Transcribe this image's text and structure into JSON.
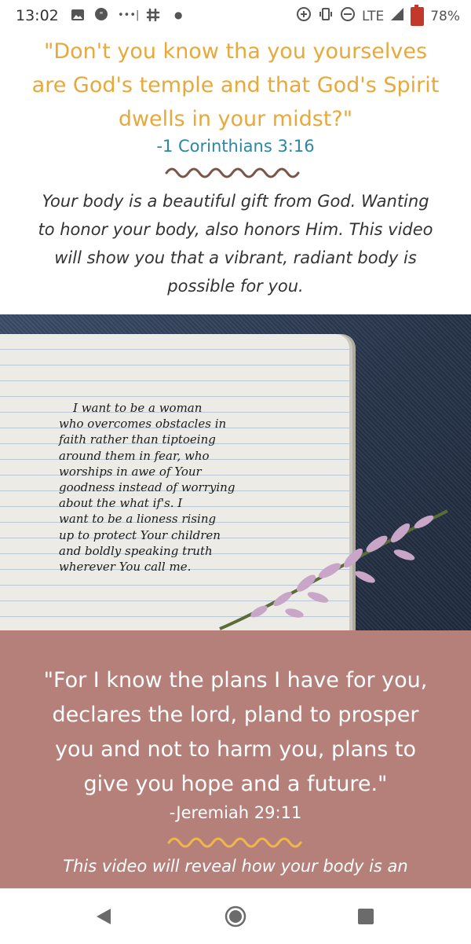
{
  "status": {
    "time": "13:02",
    "network": "LTE",
    "battery": "78%"
  },
  "quote1": {
    "lines": [
      "\"Don't you know tha you yourselves",
      "are God's temple and that God's Spirit",
      "dwells in your midst?\""
    ],
    "reference": "-1 Corinthians 3:16"
  },
  "intro": {
    "lines": [
      "Your body is a beautiful gift from God. Wanting",
      "to honor your body, also honors Him. This video",
      "will show you that a vibrant, radiant body is",
      "possible for you."
    ]
  },
  "journal": {
    "lines": [
      "I want to be a woman",
      "who overcomes obstacles in",
      "faith rather than tiptoeing",
      "around them in fear, who",
      "worships in awe of Your",
      "goodness instead of worrying",
      "about the what if's. I",
      "want to be a lioness rising",
      "up to protect Your children",
      "and boldly speaking truth",
      "wherever You call me."
    ]
  },
  "quote2": {
    "lines": [
      "\"For I know the plans I have for you,",
      "declares the lord, pland to prosper",
      "you and not to harm you, plans to",
      "give you hope and a future.\""
    ],
    "reference": "-Jeremiah 29:11"
  },
  "teaser": {
    "text": "This video will reveal how your body is an"
  },
  "colors": {
    "quote1": "#e7a93b",
    "reference": "#2a87a4",
    "rose_background": "#b5807a"
  }
}
